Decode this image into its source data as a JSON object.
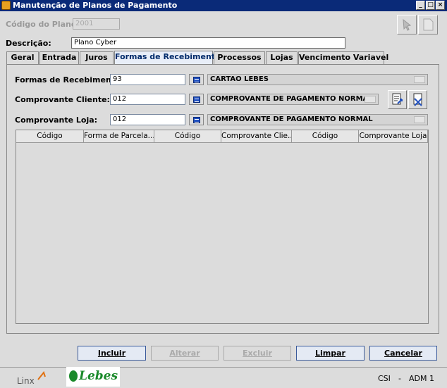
{
  "window": {
    "title": "Manutenção de Planos de Pagamento"
  },
  "header": {
    "codigo_label": "Código do Plano:",
    "codigo_value": "2001",
    "descricao_label": "Descrição:",
    "descricao_value": "Plano Cyber"
  },
  "tabs": [
    {
      "label": "Geral"
    },
    {
      "label": "Entrada"
    },
    {
      "label": "Juros"
    },
    {
      "label": "Formas de Recebimento"
    },
    {
      "label": "Processos"
    },
    {
      "label": "Lojas"
    },
    {
      "label": "Vencimento Variavel"
    }
  ],
  "form": {
    "formas_label": "Formas de Recebimento:",
    "formas_value": "93",
    "formas_desc": "CARTAO LEBES",
    "cliente_label": "Comprovante Cliente:",
    "cliente_value": "012",
    "cliente_desc": "COMPROVANTE DE PAGAMENTO NORMAL",
    "loja_label": "Comprovante Loja:",
    "loja_value": "012",
    "loja_desc": "COMPROVANTE DE PAGAMENTO NORMAL"
  },
  "grid": {
    "columns": [
      "Código",
      "Forma de Parcela...",
      "Código",
      "Comprovante Clie...",
      "Código",
      "Comprovante Loja"
    ],
    "rows": []
  },
  "buttons": {
    "incluir": "Incluir",
    "alterar": "Alterar",
    "excluir": "Excluir",
    "limpar": "Limpar",
    "cancelar": "Cancelar"
  },
  "statusbar": {
    "linx_logo": "Linx",
    "lebes_logo": "Lebes",
    "csi": "CSI",
    "sep": "-",
    "user": "ADM 1"
  },
  "colors": {
    "title_bar": "#0a2a78",
    "accent": "#2050c0",
    "lebes_green": "#1a8a2a"
  }
}
